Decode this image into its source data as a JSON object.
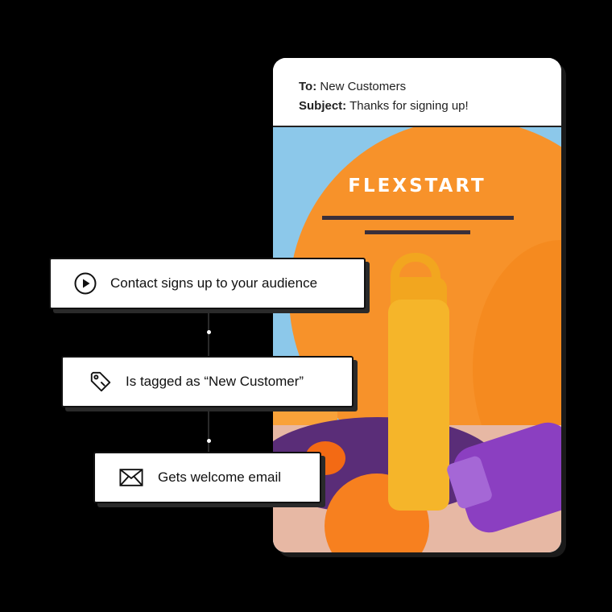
{
  "email": {
    "to_label": "To:",
    "to_value": "New Customers",
    "subject_label": "Subject:",
    "subject_value": "Thanks for signing up!",
    "brand": "FLEXSTART"
  },
  "workflow": {
    "steps": [
      {
        "icon": "play-circle-icon",
        "label": "Contact signs up to your audience"
      },
      {
        "icon": "tag-icon",
        "label": "Is tagged as “New Customer”"
      },
      {
        "icon": "envelope-icon",
        "label": "Gets welcome email"
      }
    ]
  },
  "colors": {
    "background": "#000000",
    "hero_orange": "#f7922a",
    "bottle_yellow": "#f5b52a",
    "accent_purple": "#8b3fc1",
    "sky_blue": "#8cc8ea"
  }
}
